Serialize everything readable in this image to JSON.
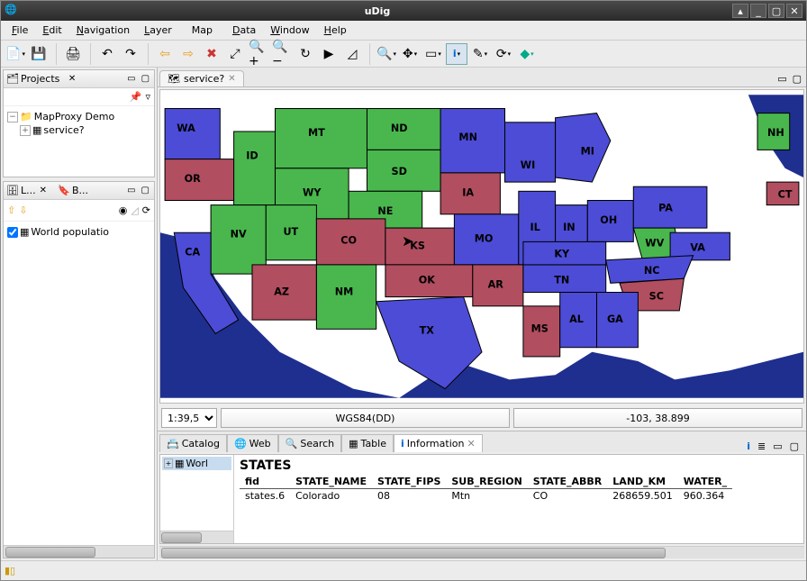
{
  "titlebar": {
    "title": "uDig"
  },
  "menu": {
    "file": "File",
    "edit": "Edit",
    "navigation": "Navigation",
    "layer": "Layer",
    "map": "Map",
    "data": "Data",
    "window": "Window",
    "help": "Help"
  },
  "projects": {
    "title": "Projects",
    "root": "MapProxy Demo",
    "child": "service?"
  },
  "layers": {
    "tab1": "L...",
    "tab2": "B...",
    "item": "World populatio"
  },
  "map_tab": {
    "label": "service?"
  },
  "map_footer": {
    "scale": "1:39,5",
    "crs": "WGS84(DD)",
    "coord": "-103, 38.899"
  },
  "bottom": {
    "catalog": "Catalog",
    "web": "Web",
    "search": "Search",
    "table": "Table",
    "information": "Information"
  },
  "info": {
    "tree_label": "Worl",
    "title": "STATES",
    "cols": [
      "fid",
      "STATE_NAME",
      "STATE_FIPS",
      "SUB_REGION",
      "STATE_ABBR",
      "LAND_KM",
      "WATER_"
    ],
    "row": [
      "states.6",
      "Colorado",
      "08",
      "Mtn",
      "CO",
      "268659.501",
      "960.364"
    ]
  },
  "state_labels": [
    "WA",
    "OR",
    "ID",
    "MT",
    "ND",
    "SD",
    "MN",
    "WI",
    "MI",
    "NH",
    "CT",
    "WY",
    "NE",
    "IA",
    "NV",
    "UT",
    "CO",
    "KS",
    "MO",
    "IL",
    "IN",
    "OH",
    "PA",
    "WV",
    "CA",
    "AZ",
    "NM",
    "OK",
    "AR",
    "TN",
    "KY",
    "VA",
    "NC",
    "SC",
    "TX",
    "MS",
    "AL",
    "GA"
  ],
  "info_icon": "i",
  "chart_data": {
    "type": "map",
    "title": "US States (colored feature layer)",
    "color_key": {
      "blue": "#4c4cd7",
      "green": "#49b74e",
      "red": "#b14e60"
    },
    "selected_feature": {
      "fid": "states.6",
      "STATE_NAME": "Colorado",
      "STATE_FIPS": "08",
      "SUB_REGION": "Mtn",
      "STATE_ABBR": "CO",
      "LAND_KM": 268659.501,
      "WATER_": 960.364
    },
    "cursor_coord": {
      "lon": -103,
      "lat": 38.899
    },
    "scale": "1:39,500,000 (approx)",
    "crs": "WGS84(DD)",
    "states": [
      {
        "abbr": "WA",
        "color": "blue"
      },
      {
        "abbr": "OR",
        "color": "red"
      },
      {
        "abbr": "CA",
        "color": "blue"
      },
      {
        "abbr": "ID",
        "color": "green"
      },
      {
        "abbr": "NV",
        "color": "green"
      },
      {
        "abbr": "UT",
        "color": "green"
      },
      {
        "abbr": "AZ",
        "color": "red"
      },
      {
        "abbr": "MT",
        "color": "green"
      },
      {
        "abbr": "WY",
        "color": "green"
      },
      {
        "abbr": "CO",
        "color": "red"
      },
      {
        "abbr": "NM",
        "color": "green"
      },
      {
        "abbr": "ND",
        "color": "green"
      },
      {
        "abbr": "SD",
        "color": "green"
      },
      {
        "abbr": "NE",
        "color": "green"
      },
      {
        "abbr": "KS",
        "color": "red"
      },
      {
        "abbr": "OK",
        "color": "red"
      },
      {
        "abbr": "TX",
        "color": "blue"
      },
      {
        "abbr": "MN",
        "color": "blue"
      },
      {
        "abbr": "IA",
        "color": "red"
      },
      {
        "abbr": "MO",
        "color": "blue"
      },
      {
        "abbr": "AR",
        "color": "red"
      },
      {
        "abbr": "MS",
        "color": "red"
      },
      {
        "abbr": "WI",
        "color": "blue"
      },
      {
        "abbr": "IL",
        "color": "blue"
      },
      {
        "abbr": "MI",
        "color": "blue"
      },
      {
        "abbr": "IN",
        "color": "blue"
      },
      {
        "abbr": "OH",
        "color": "blue"
      },
      {
        "abbr": "KY",
        "color": "blue"
      },
      {
        "abbr": "TN",
        "color": "blue"
      },
      {
        "abbr": "AL",
        "color": "blue"
      },
      {
        "abbr": "GA",
        "color": "blue"
      },
      {
        "abbr": "SC",
        "color": "red"
      },
      {
        "abbr": "NC",
        "color": "blue"
      },
      {
        "abbr": "VA",
        "color": "blue"
      },
      {
        "abbr": "WV",
        "color": "green"
      },
      {
        "abbr": "PA",
        "color": "blue"
      },
      {
        "abbr": "NH",
        "color": "green"
      },
      {
        "abbr": "CT",
        "color": "red"
      }
    ]
  }
}
